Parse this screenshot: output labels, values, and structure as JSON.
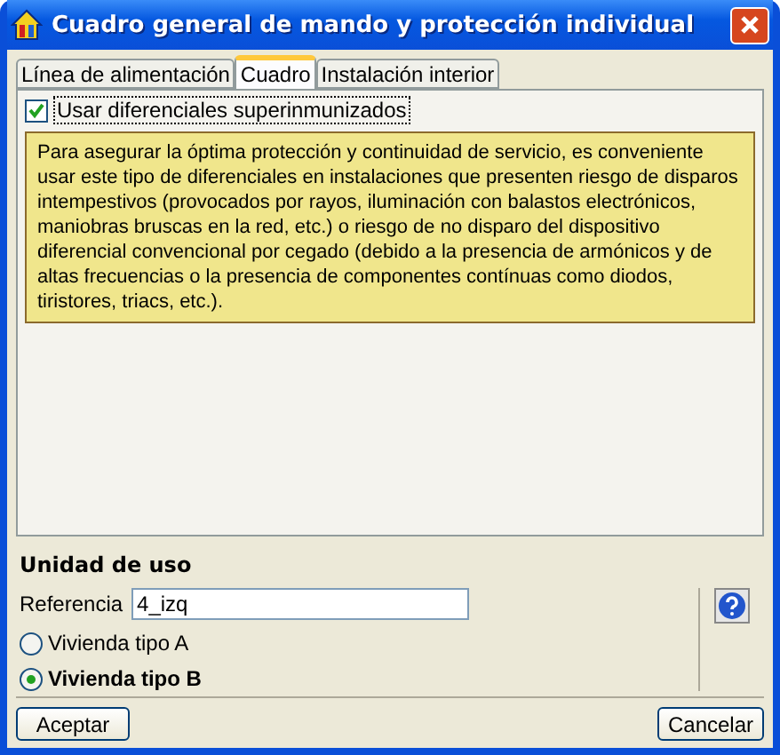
{
  "window": {
    "title": "Cuadro general de mando y protección individual"
  },
  "tabs": [
    {
      "label": "Línea de alimentación",
      "selected": false
    },
    {
      "label": "Cuadro",
      "selected": true
    },
    {
      "label": "Instalación interior",
      "selected": false
    }
  ],
  "panel": {
    "checkbox": {
      "label": "Usar diferenciales superinmunizados",
      "checked": true
    },
    "note": "Para asegurar la óptima protección y continuidad de servicio, es conveniente usar este tipo de diferenciales en instalaciones que presenten riesgo de disparos intempestivos (provocados por rayos, iluminación con balastos electrónicos, maniobras bruscas en la red, etc.) o riesgo de no disparo del dispositivo diferencial convencional por cegado (debido a la presencia de armónicos y de altas frecuencias o la presencia de componentes contínuas como diodos, tiristores, triacs, etc.)."
  },
  "unit": {
    "heading": "Unidad de uso",
    "reference_label": "Referencia",
    "reference_value": "4_izq",
    "options": [
      {
        "label": "Vivienda tipo A",
        "selected": false
      },
      {
        "label": "Vivienda tipo B",
        "selected": true
      }
    ]
  },
  "buttons": [
    {
      "label": "Aceptar"
    },
    {
      "label": "Cancelar"
    }
  ]
}
